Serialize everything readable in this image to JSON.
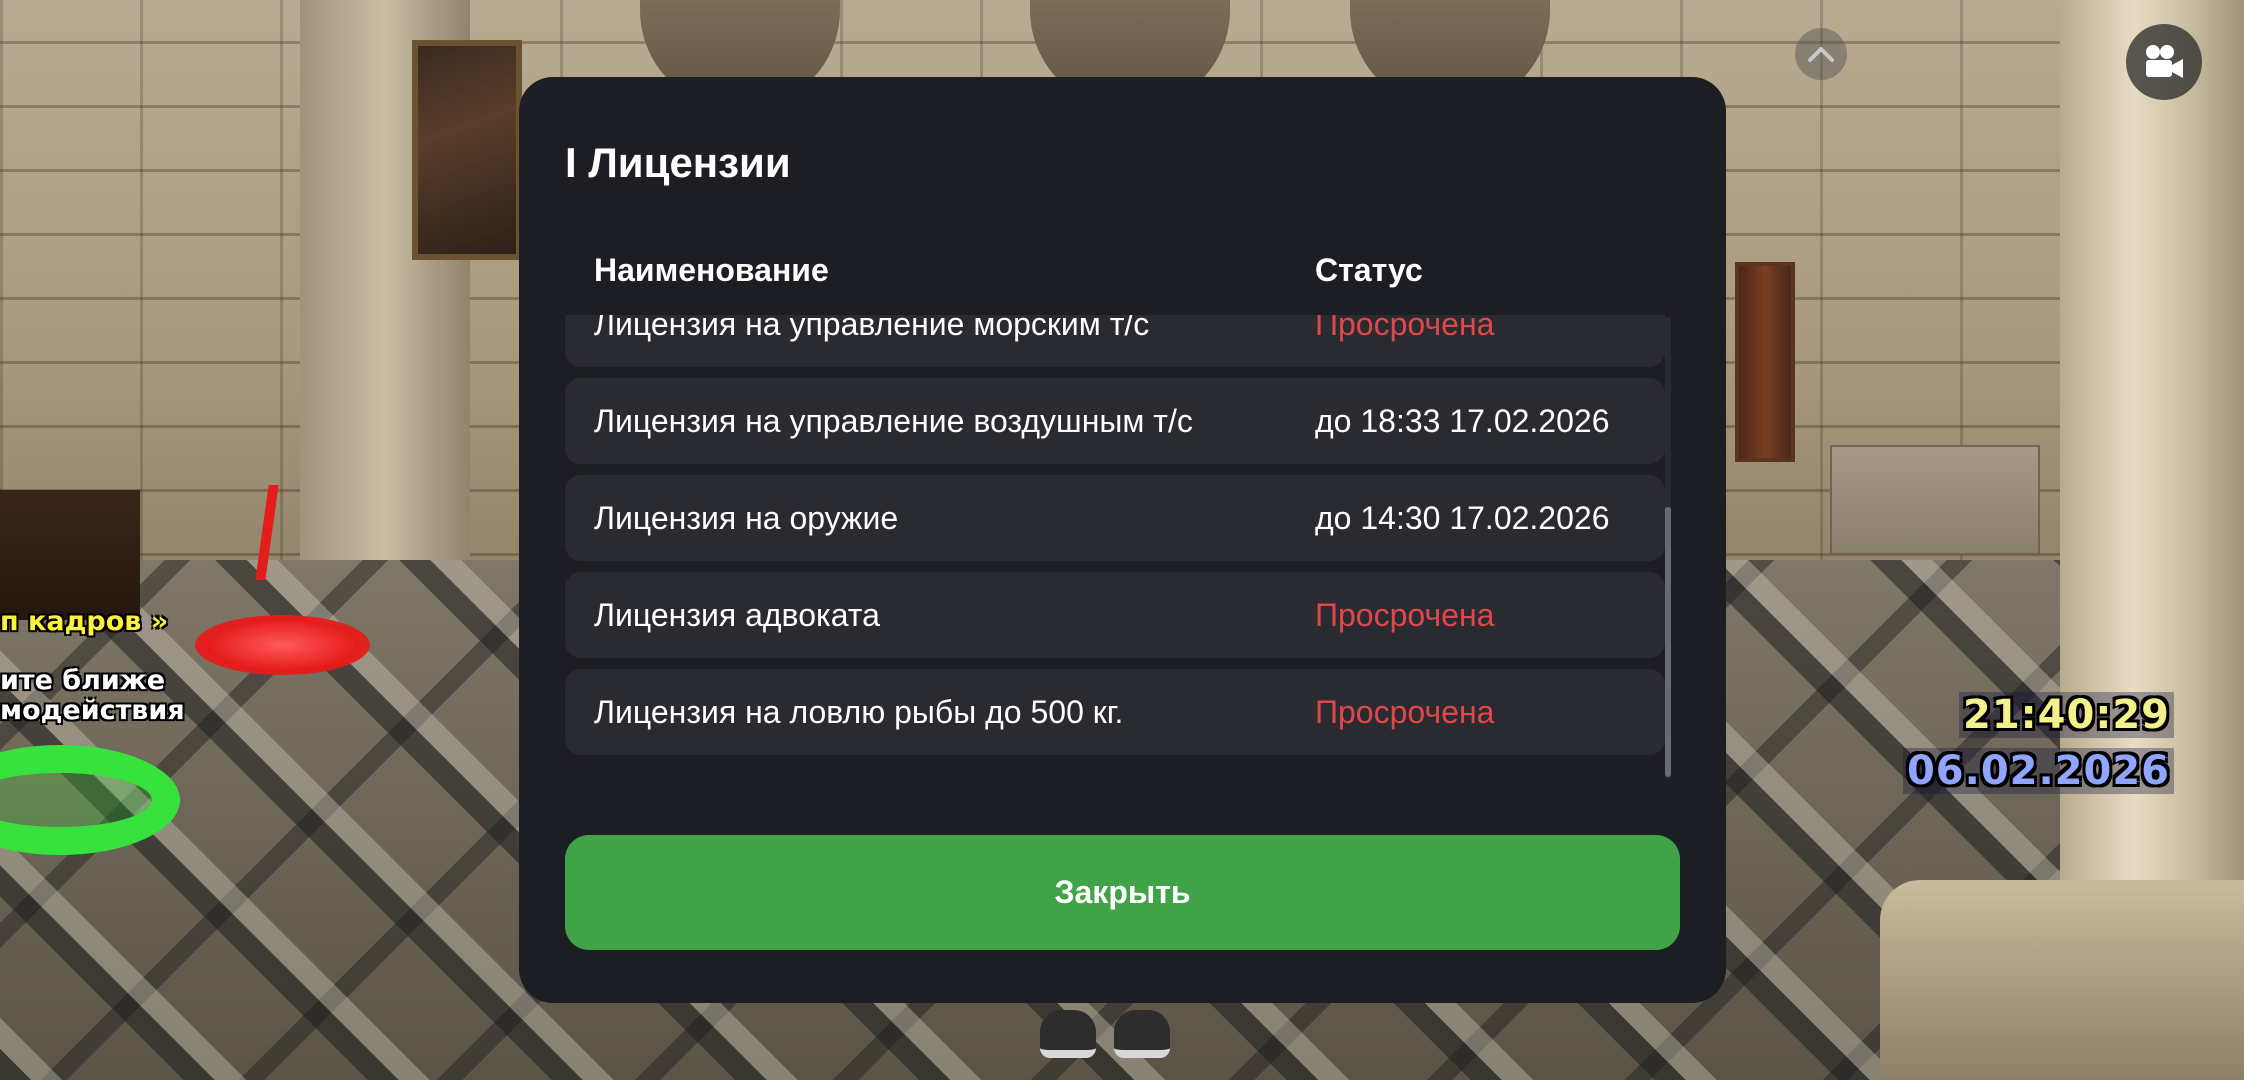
{
  "modal": {
    "title": "I Лицензии",
    "columns": {
      "name": "Наименование",
      "status": "Статус"
    },
    "rows": [
      {
        "name": "Лицензия на управление морским т/с",
        "status": "Просрочена",
        "expired": true
      },
      {
        "name": "Лицензия на управление воздушным т/с",
        "status": "до 18:33 17.02.2026",
        "expired": false
      },
      {
        "name": "Лицензия на оружие",
        "status": "до 14:30 17.02.2026",
        "expired": false
      },
      {
        "name": "Лицензия адвоката",
        "status": "Просрочена",
        "expired": true
      },
      {
        "name": "Лицензия на ловлю рыбы до 500 кг.",
        "status": "Просрочена",
        "expired": true
      }
    ],
    "close_label": "Закрыть"
  },
  "hud": {
    "time": "21:40:29",
    "date": "06.02.2026",
    "up_icon": "chevron-up-icon",
    "camera_icon": "video-camera-icon"
  },
  "world_text": {
    "line1": "п кадров »",
    "line2": "ите ближе",
    "line3": "модействия"
  },
  "colors": {
    "modal_bg": "#1d1e23",
    "row_bg": "#2a2b31",
    "expired": "#e0474a",
    "button": "#41a347"
  }
}
